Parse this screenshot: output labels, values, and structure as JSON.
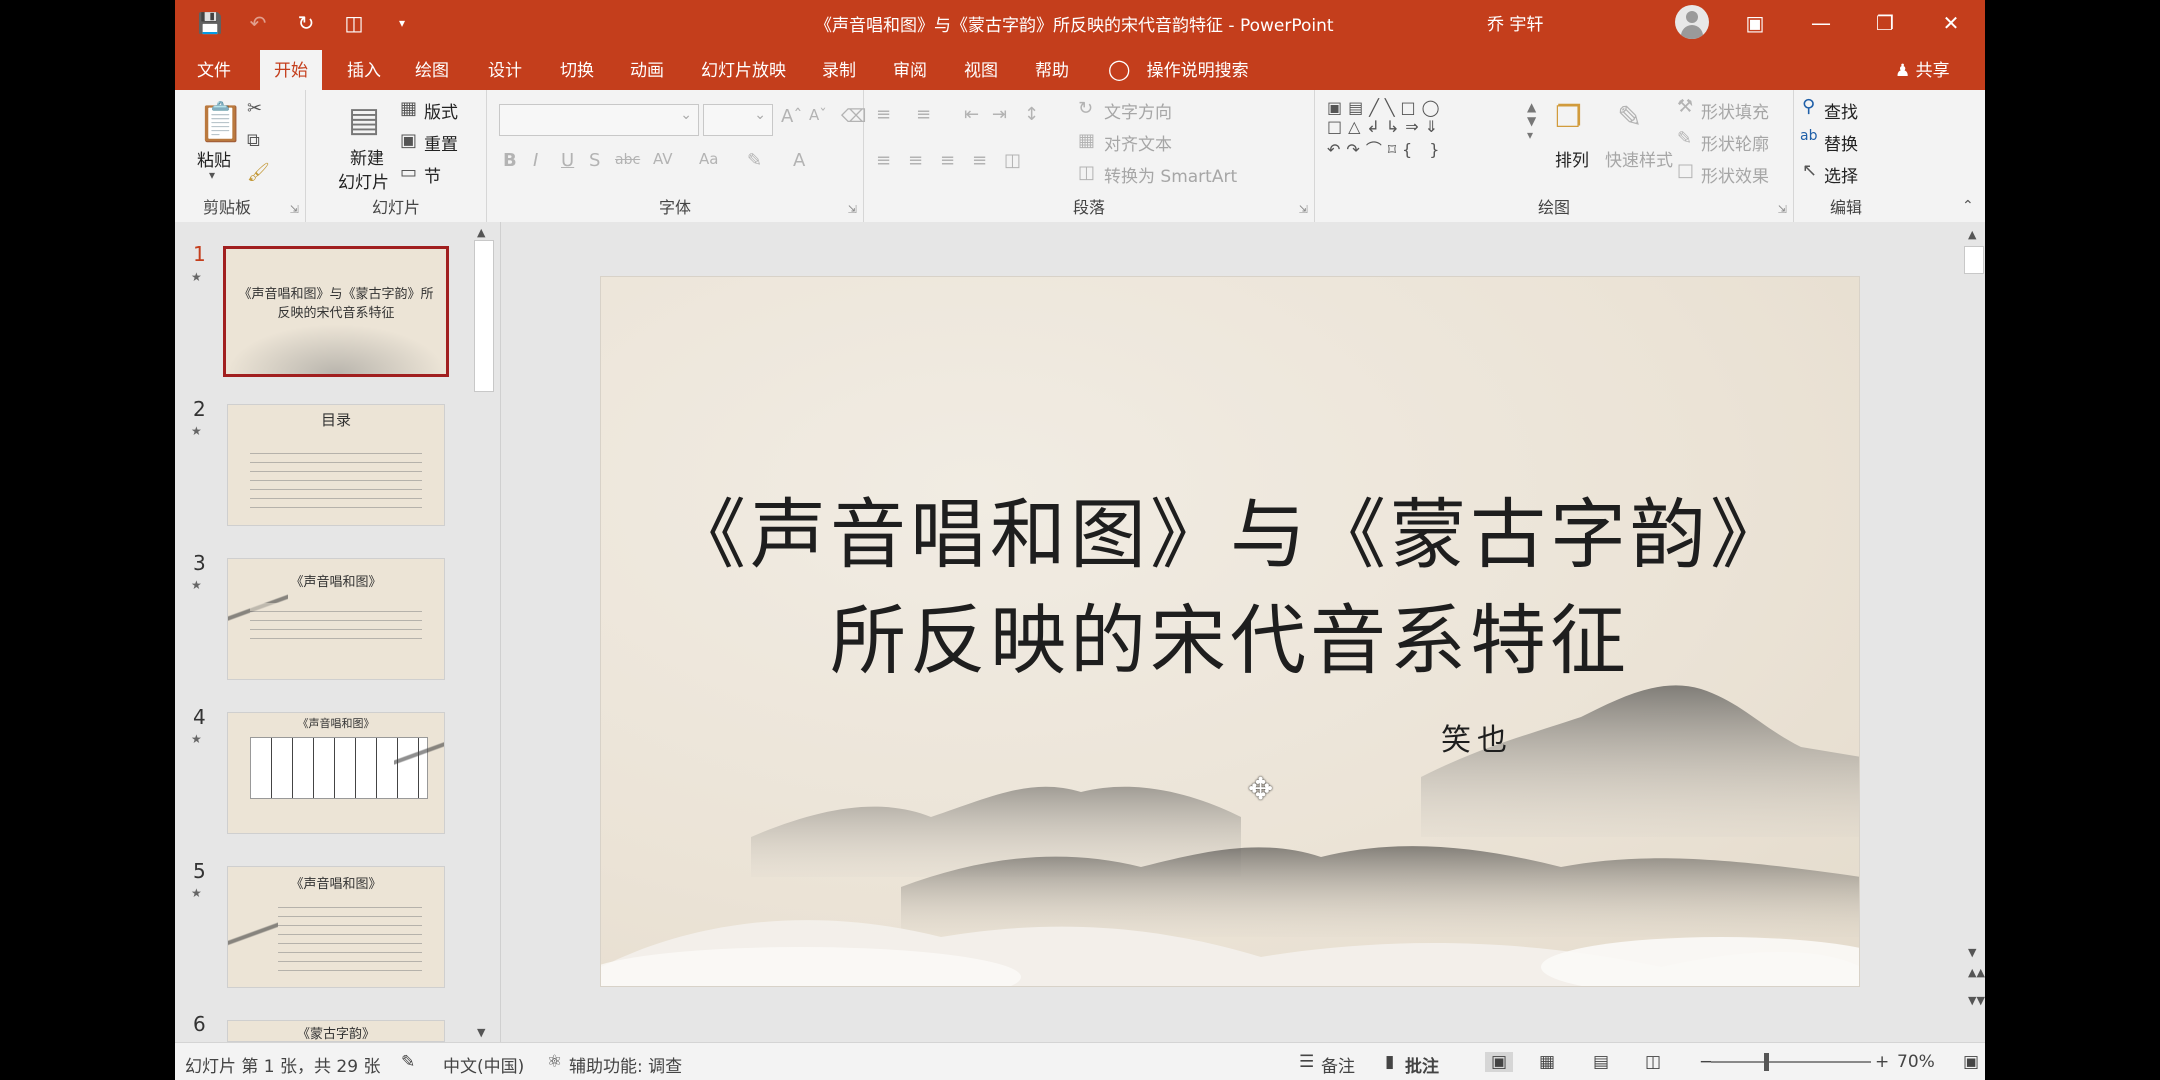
{
  "titlebar": {
    "document_title": "《声音唱和图》与《蒙古字韵》所反映的宋代音韵特征  -  PowerPoint",
    "user_name": "乔 宇轩",
    "qat": [
      "save-icon",
      "undo-icon",
      "redo-icon",
      "presentation-icon",
      "customize-qat-icon"
    ]
  },
  "tabs": [
    "文件",
    "开始",
    "插入",
    "绘图",
    "设计",
    "切换",
    "动画",
    "幻灯片放映",
    "录制",
    "审阅",
    "视图",
    "帮助"
  ],
  "active_tab": "开始",
  "tell_me": "操作说明搜索",
  "share": "共享",
  "ribbon": {
    "clipboard": {
      "label": "剪贴板",
      "paste": "粘贴"
    },
    "slides": {
      "label": "幻灯片",
      "new_slide_1": "新建",
      "new_slide_2": "幻灯片",
      "layout": "版式",
      "reset": "重置",
      "section": "节"
    },
    "font": {
      "label": "字体"
    },
    "paragraph": {
      "label": "段落",
      "text_direction": "文字方向",
      "align_text": "对齐文本",
      "smartart": "转换为 SmartArt"
    },
    "drawing": {
      "label": "绘图",
      "arrange": "排列",
      "quick_styles": "快速样式",
      "shape_fill": "形状填充",
      "shape_outline": "形状轮廓",
      "shape_effects": "形状效果"
    },
    "editing": {
      "label": "编辑",
      "find": "查找",
      "replace": "替换",
      "select": "选择"
    }
  },
  "slides": [
    {
      "num": "1",
      "title": "《声音唱和图》与《蒙古字韵》所反映的宋代音系特征"
    },
    {
      "num": "2",
      "title": "目录"
    },
    {
      "num": "3",
      "title": "《声音唱和图》"
    },
    {
      "num": "4",
      "title": "《声音唱和图》"
    },
    {
      "num": "5",
      "title": "《声音唱和图》"
    },
    {
      "num": "6",
      "title": "《蒙古字韵》"
    }
  ],
  "main_slide": {
    "title_line1": "《声音唱和图》与《蒙古字韵》",
    "title_line2": "所反映的宋代音系特征",
    "author": "笑也"
  },
  "status": {
    "slide_info": "幻灯片 第 1 张，共 29 张",
    "language": "中文(中国)",
    "accessibility": "辅助功能: 调查",
    "notes": "备注",
    "comments": "批注",
    "zoom": "70%"
  },
  "colors": {
    "accent": "#c43e1c",
    "active_thumb_border": "#a11f1f"
  }
}
